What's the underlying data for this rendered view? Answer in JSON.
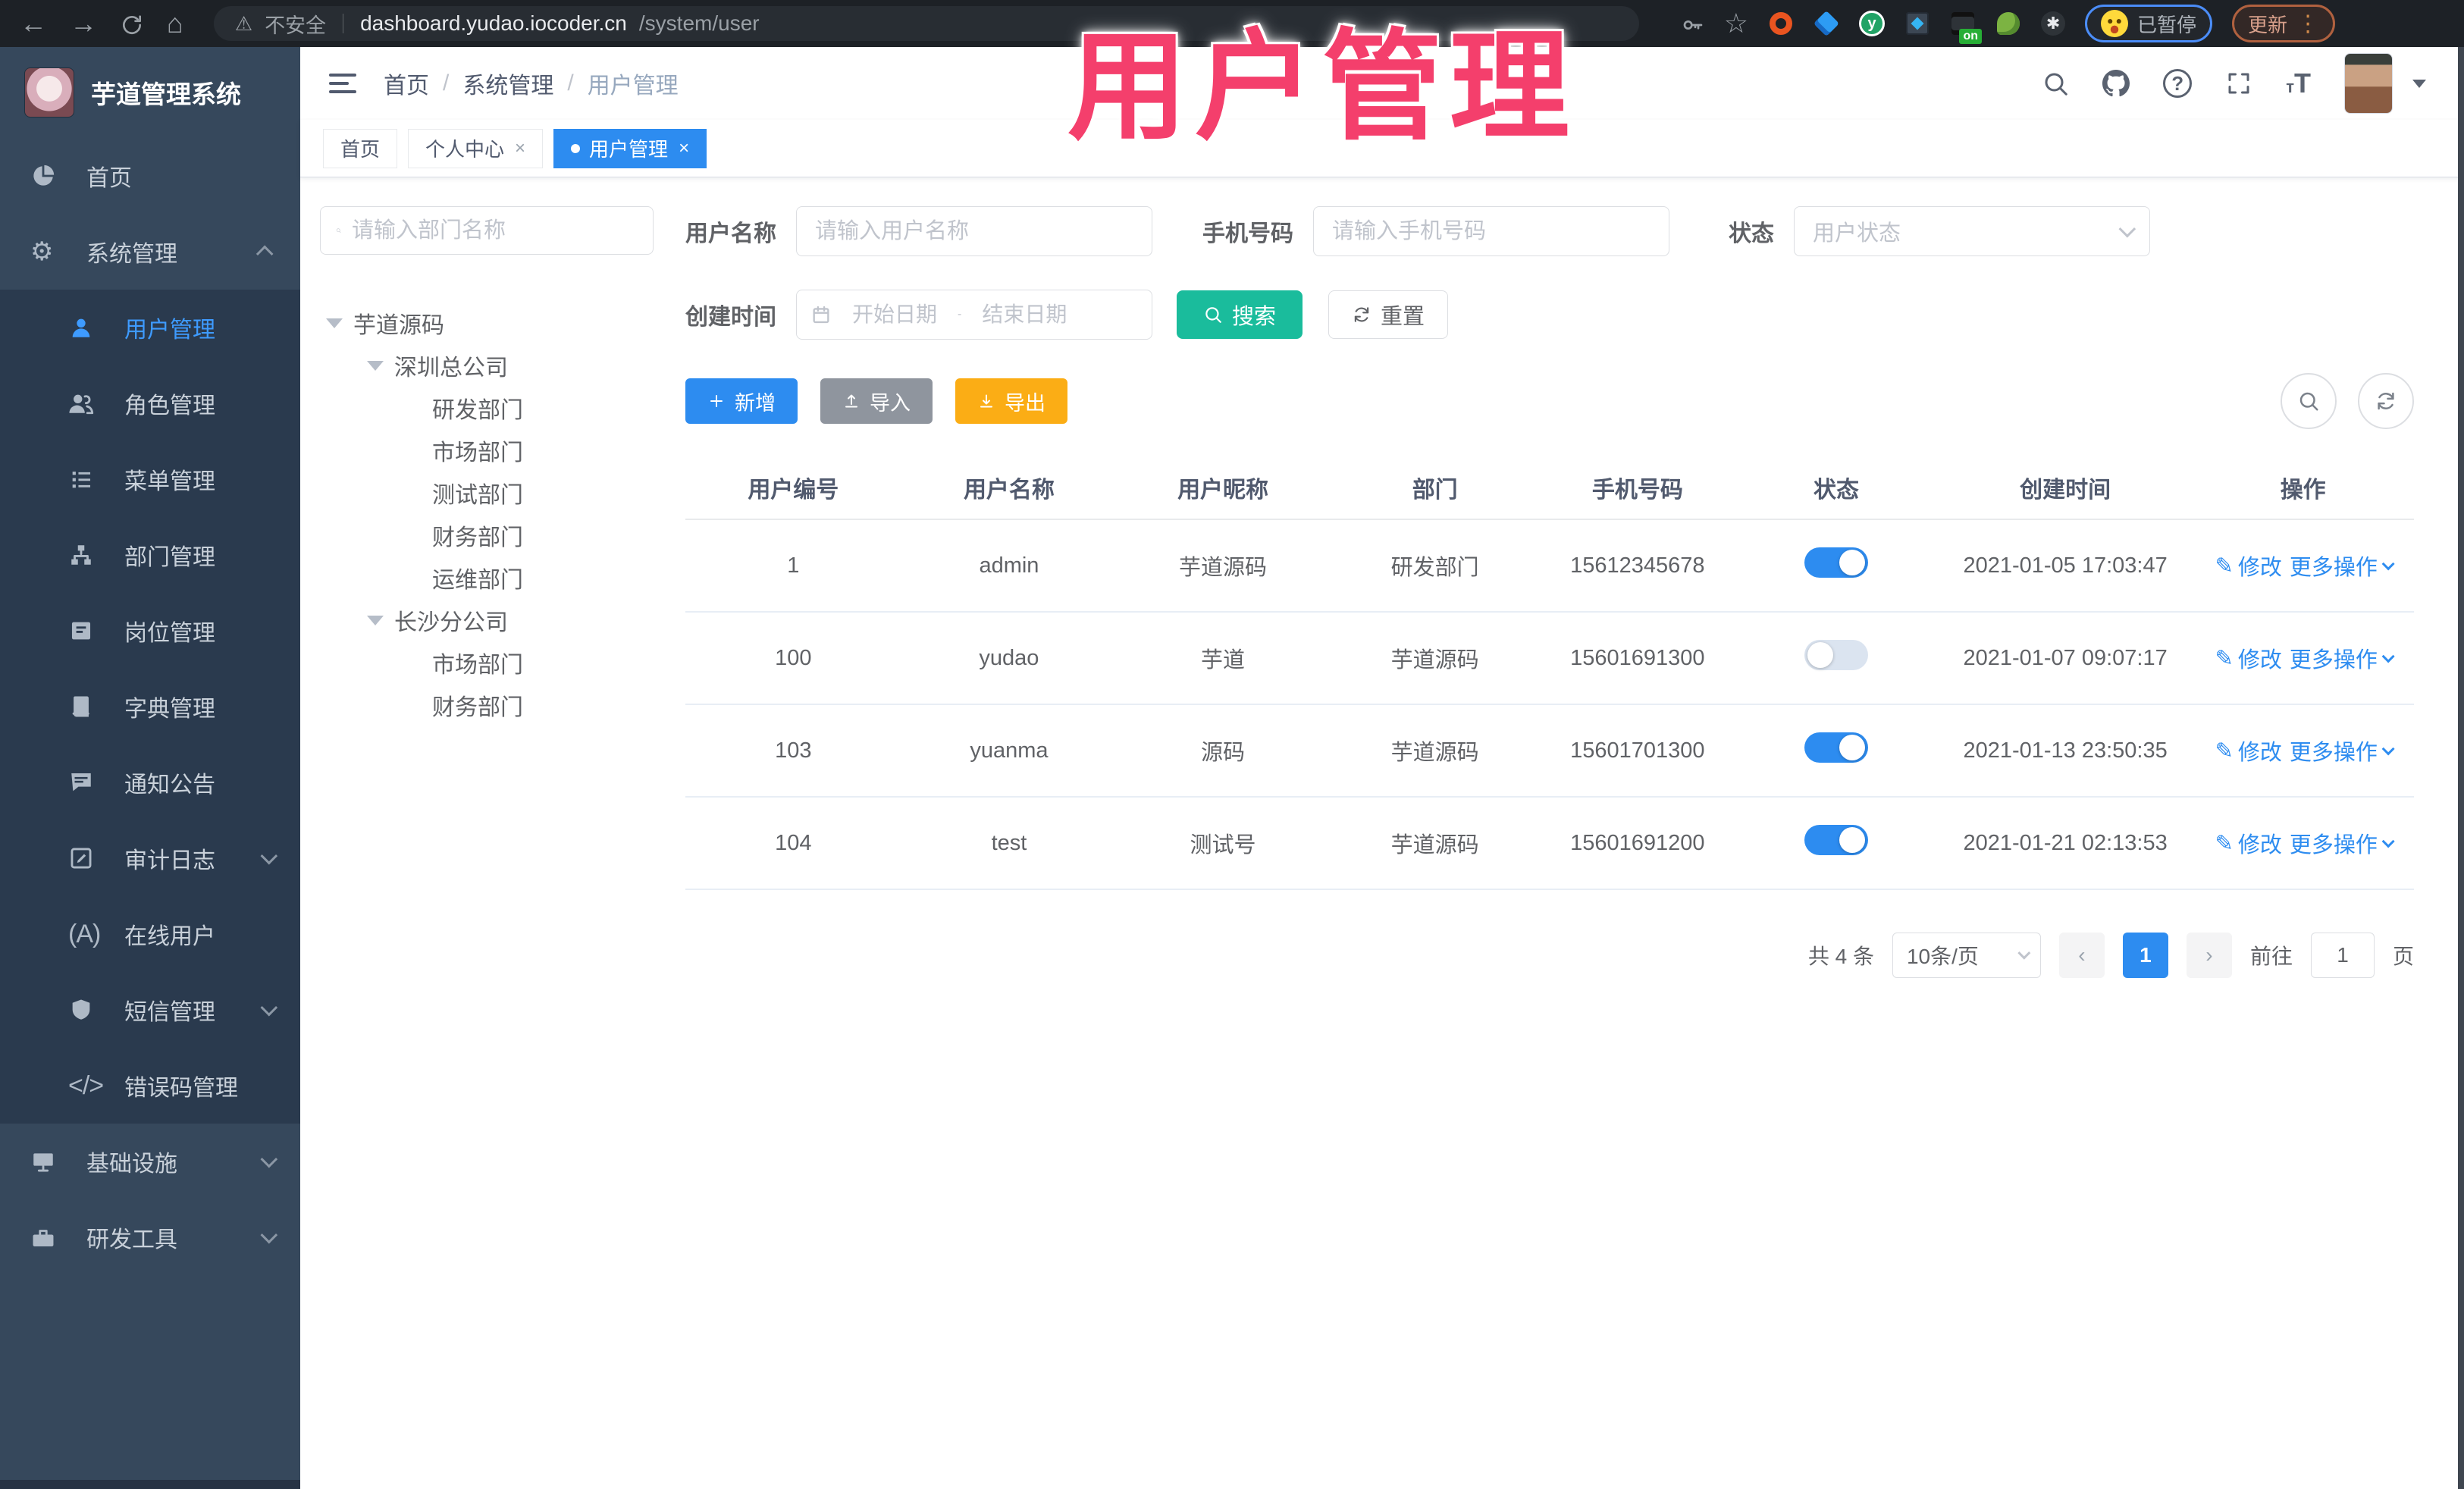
{
  "browser": {
    "security_label": "不安全",
    "url_host": "dashboard.yudao.iocoder.cn",
    "url_path": "/system/user",
    "extension_y_letter": "y",
    "extension_on_badge": "on",
    "paused_badge": "已暂停",
    "update_button": "更新"
  },
  "icons": {
    "back": "←",
    "forward": "→",
    "home": "⌂",
    "warning": "⚠",
    "star": "☆",
    "kebab": "⋮",
    "gear": "⚙",
    "pencil": "✎",
    "code": "</>",
    "online": "(A)",
    "pinwheel": "✱",
    "chevron_left": "‹",
    "chevron_right": "›",
    "small_t": "т",
    "big_t": "T",
    "question": "?"
  },
  "overlay_title": {
    "text": "用户管理",
    "color": "#f43f6c"
  },
  "app_header": {
    "breadcrumb": [
      "首页",
      "系统管理",
      "用户管理"
    ],
    "separator": "/"
  },
  "sidebar": {
    "app_title": "芋道管理系统",
    "items": [
      {
        "label": "首页"
      },
      {
        "label": "系统管理"
      },
      {
        "label": "用户管理"
      },
      {
        "label": "角色管理"
      },
      {
        "label": "菜单管理"
      },
      {
        "label": "部门管理"
      },
      {
        "label": "岗位管理"
      },
      {
        "label": "字典管理"
      },
      {
        "label": "通知公告"
      },
      {
        "label": "审计日志"
      },
      {
        "label": "在线用户"
      },
      {
        "label": "短信管理"
      },
      {
        "label": "错误码管理"
      },
      {
        "label": "基础设施"
      },
      {
        "label": "研发工具"
      }
    ]
  },
  "tabs": [
    {
      "label": "首页"
    },
    {
      "label": "个人中心",
      "close": "×"
    },
    {
      "label": "用户管理",
      "close": "×"
    }
  ],
  "dept_tree": {
    "search_placeholder": "请输入部门名称",
    "nodes": [
      "芋道源码",
      "深圳总公司",
      "研发部门",
      "市场部门",
      "测试部门",
      "财务部门",
      "运维部门",
      "长沙分公司",
      "市场部门",
      "财务部门"
    ]
  },
  "filters": {
    "username_label": "用户名称",
    "username_placeholder": "请输入用户名称",
    "mobile_label": "手机号码",
    "mobile_placeholder": "请输入手机号码",
    "status_label": "状态",
    "status_placeholder": "用户状态",
    "create_time_label": "创建时间",
    "date_start_placeholder": "开始日期",
    "date_separator": "-",
    "date_end_placeholder": "结束日期",
    "search_button": "搜索",
    "reset_button": "重置"
  },
  "toolbar": {
    "add_button": "新增",
    "import_button": "导入",
    "export_button": "导出"
  },
  "table": {
    "headers": [
      "用户编号",
      "用户名称",
      "用户昵称",
      "部门",
      "手机号码",
      "状态",
      "创建时间",
      "操作"
    ],
    "action_edit": "修改",
    "action_more": "更多操作",
    "rows": [
      {
        "id": "1",
        "username": "admin",
        "nickname": "芋道源码",
        "dept": "研发部门",
        "mobile": "15612345678",
        "status_on": true,
        "created": "2021-01-05 17:03:47"
      },
      {
        "id": "100",
        "username": "yudao",
        "nickname": "芋道",
        "dept": "芋道源码",
        "mobile": "15601691300",
        "status_on": false,
        "created": "2021-01-07 09:07:17"
      },
      {
        "id": "103",
        "username": "yuanma",
        "nickname": "源码",
        "dept": "芋道源码",
        "mobile": "15601701300",
        "status_on": true,
        "created": "2021-01-13 23:50:35"
      },
      {
        "id": "104",
        "username": "test",
        "nickname": "测试号",
        "dept": "芋道源码",
        "mobile": "15601691200",
        "status_on": true,
        "created": "2021-01-21 02:13:53"
      }
    ]
  },
  "pagination": {
    "total_text": "共 4 条",
    "page_size": "10条/页",
    "current_page": "1",
    "goto_label": "前往",
    "goto_value": "1",
    "page_unit": "页"
  }
}
